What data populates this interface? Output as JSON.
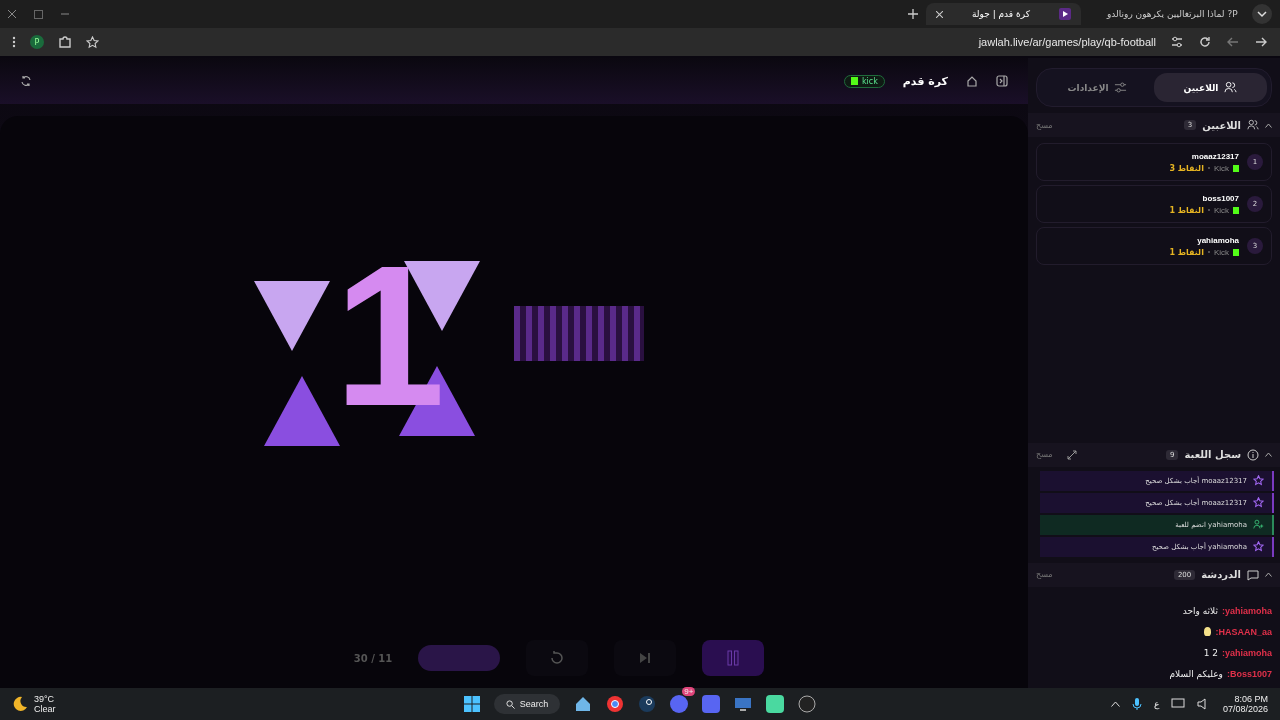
{
  "browser": {
    "tabs": [
      {
        "title": "لماذا البرتغاليين يكرهون رونالدو ?P",
        "selected": false
      },
      {
        "title": "كرة قدم | جولة",
        "selected": true
      }
    ],
    "url": "jawlah.live/ar/games/play/qb-football",
    "profile": "P"
  },
  "game": {
    "title": "كرة قدم",
    "platform": "kick",
    "countdown": "1",
    "progress": "30 / 11"
  },
  "sidebar": {
    "tabs": [
      {
        "label": "اللاعبين",
        "selected": true
      },
      {
        "label": "الإعدادات",
        "selected": false
      }
    ],
    "players": {
      "title": "اللاعبين",
      "count": "3",
      "clear": "مسح",
      "items": [
        {
          "rank": "1",
          "name": "moaaz12317",
          "platform": "Kick",
          "points": "النقاط 3"
        },
        {
          "rank": "2",
          "name": "boss1007",
          "platform": "Kick",
          "points": "النقاط 1"
        },
        {
          "rank": "3",
          "name": "yahiamoha",
          "platform": "Kick",
          "points": "النقاط 1"
        }
      ]
    },
    "log": {
      "title": "سجل اللعبة",
      "count": "9",
      "clear": "مسح",
      "items": [
        {
          "kind": "correct",
          "text": "moaaz12317 أجاب بشكل صحيح"
        },
        {
          "kind": "correct",
          "text": "moaaz12317 أجاب بشكل صحيح"
        },
        {
          "kind": "joined",
          "text": "yahiamoha انضم للعبة"
        },
        {
          "kind": "correct",
          "text": "yahiamoha أجاب بشكل صحيح"
        }
      ]
    },
    "chat": {
      "title": "الدردشة",
      "count": "200",
      "clear": "مسح",
      "messages": [
        {
          "kind": "text",
          "user": "yahiamoha:",
          "text": "ثلاثه واحد"
        },
        {
          "kind": "emoji",
          "user": "HASAAN_aa:"
        },
        {
          "kind": "text",
          "user": "yahiamoha:",
          "text": "2 1"
        },
        {
          "kind": "text",
          "user": "Boss1007:",
          "text": "وعليكم السلام"
        }
      ]
    }
  },
  "taskbar": {
    "temperature": "39°C",
    "weather": "Clear",
    "search": "Search",
    "badge": "9+",
    "language": "ع",
    "time": "8:06 PM",
    "date": "07/08/2026"
  }
}
